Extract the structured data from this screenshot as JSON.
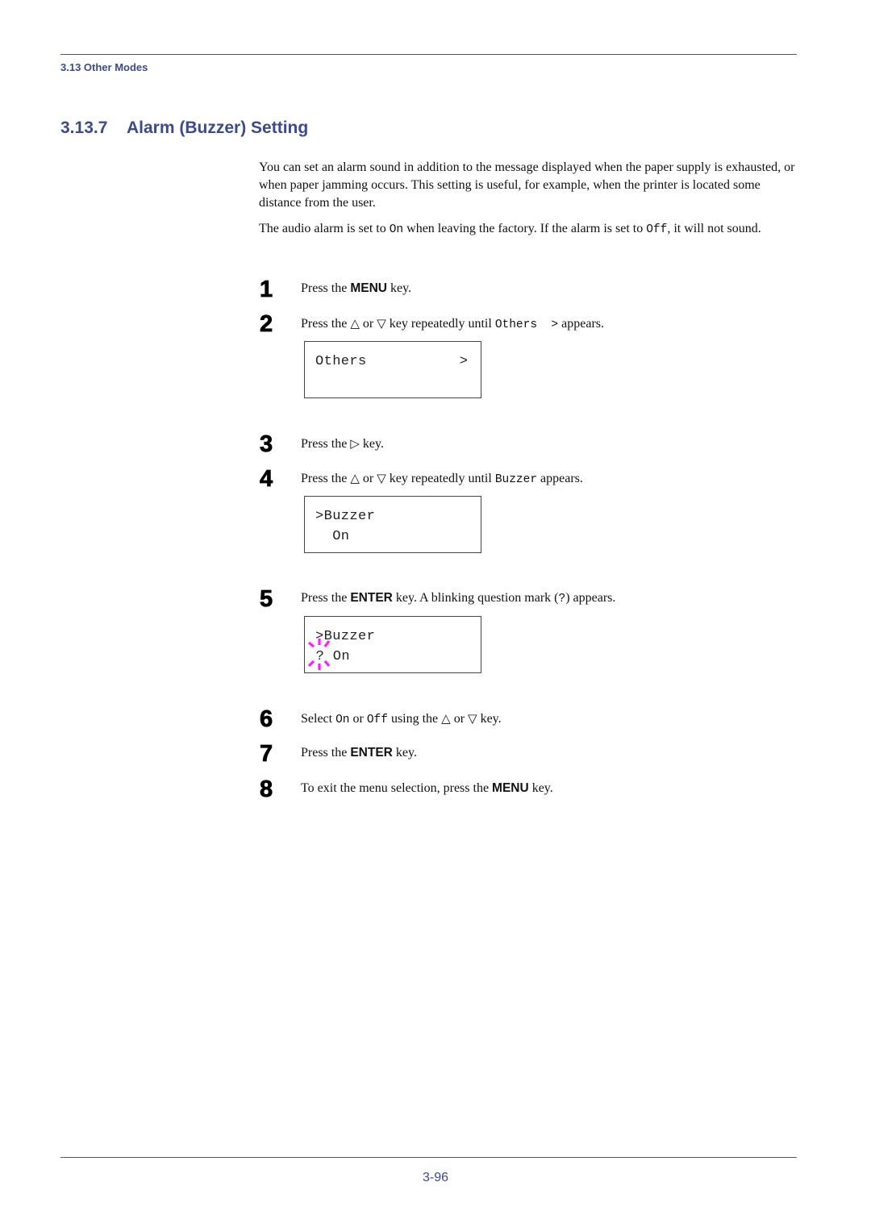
{
  "header": {
    "section_label": "3.13 Other Modes"
  },
  "title": {
    "number": "3.13.7",
    "text": "Alarm (Buzzer) Setting"
  },
  "intro": {
    "p1": "You can set an alarm sound in addition to the message displayed when the paper supply is exhausted, or when paper jamming occurs. This setting is useful, for example, when the printer is located some distance from the user.",
    "p2_a": "The audio alarm is set to ",
    "p2_on": "On",
    "p2_b": " when leaving the factory. If the alarm is set to ",
    "p2_off": "Off",
    "p2_c": ", it will not sound."
  },
  "icons": {
    "up": "△",
    "down": "▽",
    "right": "▷"
  },
  "steps": [
    {
      "num": "1",
      "a": "Press the ",
      "key": "MENU",
      "b": " key."
    },
    {
      "num": "2",
      "a": "Press the ",
      "or": " or ",
      "b": " key repeatedly until ",
      "code": "Others  >",
      "c": " appears."
    },
    {
      "num": "3",
      "a": "Press the ",
      "b": " key."
    },
    {
      "num": "4",
      "a": "Press the ",
      "or": " or ",
      "b": " key repeatedly until ",
      "code": "Buzzer",
      "c": " appears."
    },
    {
      "num": "5",
      "a": "Press the ",
      "key": "ENTER",
      "b": " key. A blinking question mark (",
      "code": "?",
      "c": ") appears."
    },
    {
      "num": "6",
      "a": "Select ",
      "code1": "On",
      "or1": " or ",
      "code2": "Off",
      "b": " using the ",
      "or": " or ",
      "c": " key."
    },
    {
      "num": "7",
      "a": "Press the ",
      "key": "ENTER",
      "b": " key."
    },
    {
      "num": "8",
      "a": "To exit the menu selection, press the ",
      "key": "MENU",
      "b": " key."
    }
  ],
  "displays": [
    {
      "line1": "Others",
      "right": ">",
      "line2": ""
    },
    {
      "line1": ">Buzzer",
      "line2": "  On"
    },
    {
      "line1": ">Buzzer",
      "line2": " ? On"
    }
  ],
  "colors": {
    "accent": "#3a4a8c",
    "blink": "#ff1aff"
  },
  "footer": {
    "page_number": "3-96"
  }
}
